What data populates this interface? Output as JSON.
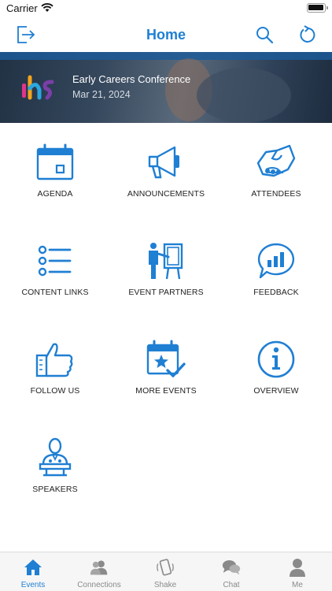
{
  "status_bar": {
    "carrier": "Carrier",
    "time": "",
    "battery_level": 1.0
  },
  "nav": {
    "title": "Home",
    "left_icon": "logout-icon",
    "right_icons": [
      "search-icon",
      "refresh-icon"
    ]
  },
  "banner": {
    "event_name": "Early Careers Conference",
    "event_date": "Mar 21, 2024",
    "logo_icon": "ihs-logo"
  },
  "tiles": [
    {
      "label": "AGENDA",
      "icon": "calendar-icon"
    },
    {
      "label": "ANNOUNCEMENTS",
      "icon": "megaphone-icon"
    },
    {
      "label": "ATTENDEES",
      "icon": "handshake-icon"
    },
    {
      "label": "CONTENT LINKS",
      "icon": "list-icon"
    },
    {
      "label": "EVENT PARTNERS",
      "icon": "presenter-icon"
    },
    {
      "label": "FEEDBACK",
      "icon": "chart-bubble-icon"
    },
    {
      "label": "FOLLOW US",
      "icon": "thumbs-up-icon"
    },
    {
      "label": "MORE EVENTS",
      "icon": "calendar-star-icon"
    },
    {
      "label": "OVERVIEW",
      "icon": "info-icon"
    },
    {
      "label": "SPEAKERS",
      "icon": "speaker-podium-icon"
    }
  ],
  "tabbar": [
    {
      "label": "Events",
      "icon": "home-icon",
      "active": true
    },
    {
      "label": "Connections",
      "icon": "people-icon",
      "active": false
    },
    {
      "label": "Shake",
      "icon": "shake-phone-icon",
      "active": false
    },
    {
      "label": "Chat",
      "icon": "chat-bubbles-icon",
      "active": false
    },
    {
      "label": "Me",
      "icon": "person-icon",
      "active": false
    }
  ],
  "colors": {
    "accent": "#1f7fd3",
    "tab_inactive": "#8a8a8a",
    "text": "#222222"
  }
}
